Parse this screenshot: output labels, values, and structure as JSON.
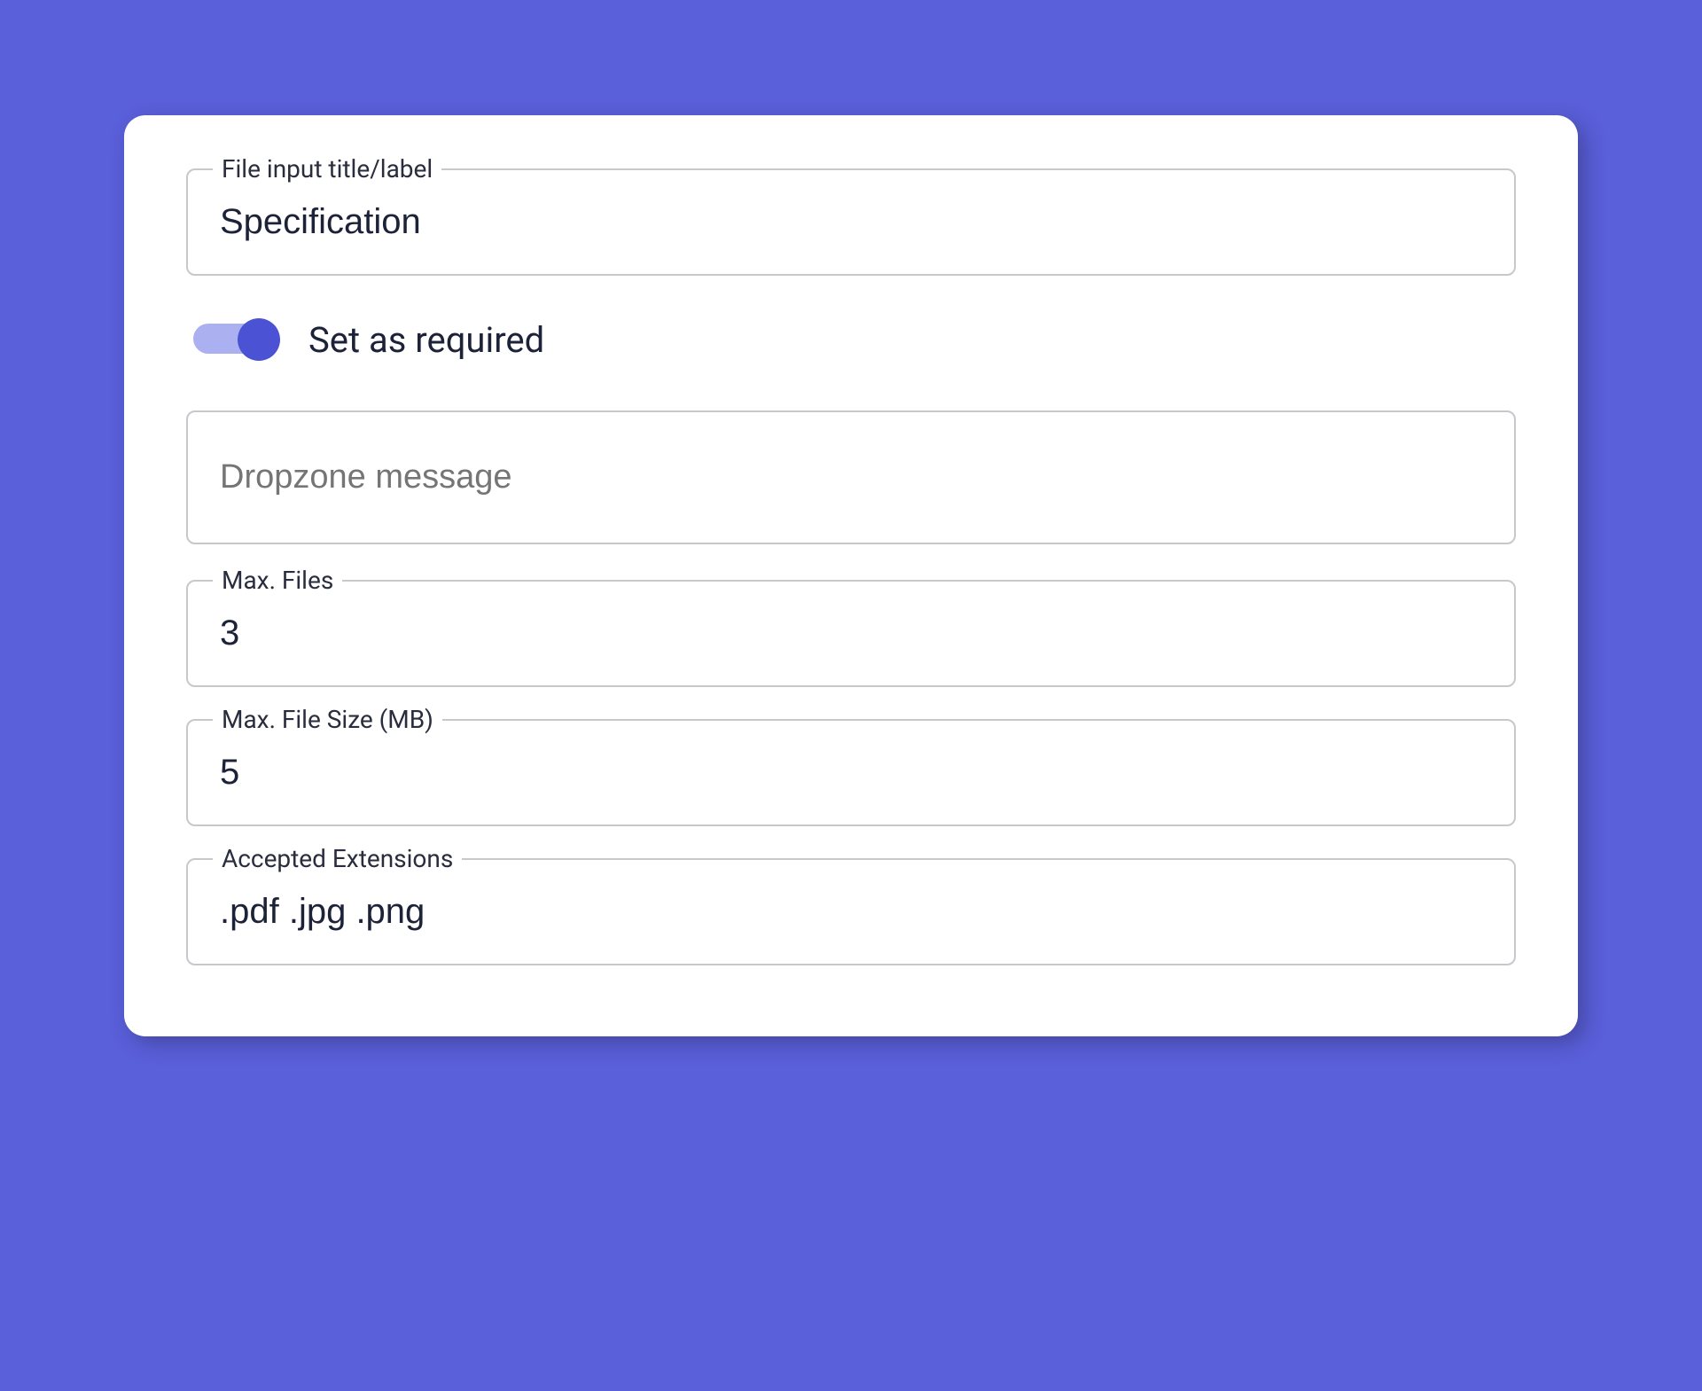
{
  "fields": {
    "title": {
      "label": "File input title/label",
      "value": "Specification"
    },
    "required": {
      "label": "Set as required",
      "enabled": true
    },
    "dropzone": {
      "placeholder": "Dropzone message",
      "value": ""
    },
    "maxFiles": {
      "label": "Max. Files",
      "value": "3"
    },
    "maxSize": {
      "label": "Max. File Size (MB)",
      "value": "5"
    },
    "extensions": {
      "label": "Accepted Extensions",
      "value": ".pdf .jpg .png"
    }
  },
  "colors": {
    "background": "#5a5fda",
    "card": "#ffffff",
    "border": "#c8c8cc",
    "text": "#1c2237",
    "toggleTrack": "#aab0f0",
    "toggleThumb": "#4c52d4"
  }
}
